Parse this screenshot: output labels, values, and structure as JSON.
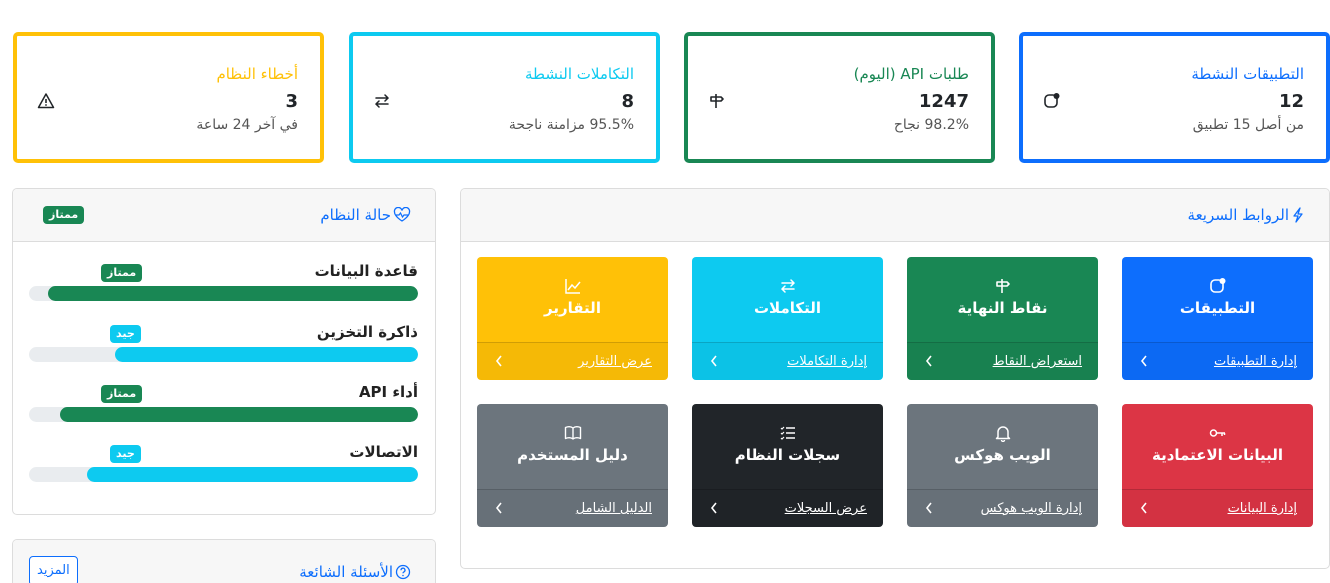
{
  "stats": [
    {
      "title": "التطبيقات النشطة",
      "value": "12",
      "sub": "من أصل 15 تطبيق",
      "color": "#0d6efd",
      "icon": "app-icon"
    },
    {
      "title": "طلبات API (اليوم)",
      "value": "1247",
      "sub": "98.2% نجاح",
      "color": "#198754",
      "icon": "signpost-icon"
    },
    {
      "title": "التكاملات النشطة",
      "value": "8",
      "sub": "95.5% مزامنة ناجحة",
      "color": "#0dcaf0",
      "icon": "arrows-exchange-icon"
    },
    {
      "title": "أخطاء النظام",
      "value": "3",
      "sub": "في آخر 24 ساعة",
      "color": "#ffc107",
      "icon": "warning-icon"
    }
  ],
  "system_status": {
    "title": "حالة النظام",
    "overall_badge": "ممتاز",
    "items": [
      {
        "label": "قاعدة البيانات",
        "badge": "ممتاز",
        "progress": 95
      },
      {
        "label": "ذاكرة التخزين",
        "badge": "جيد",
        "progress": 78
      },
      {
        "label": "أداء API",
        "badge": "ممتاز",
        "progress": 92
      },
      {
        "label": "الاتصالات",
        "badge": "جيد",
        "progress": 85
      }
    ]
  },
  "quick_links": {
    "title": "الروابط السريعة",
    "tiles": [
      {
        "title": "التطبيقات",
        "link": "إدارة التطبيقات",
        "icon": "app-icon",
        "color": "#0d6efd"
      },
      {
        "title": "نقاط النهاية",
        "link": "استعراض النقاط",
        "icon": "signpost-icon",
        "color": "#198754"
      },
      {
        "title": "التكاملات",
        "link": "إدارة التكاملات",
        "icon": "arrows-exchange-icon",
        "color": "#0dcaf0"
      },
      {
        "title": "التقارير",
        "link": "عرض التقارير",
        "icon": "chart-line-icon",
        "color": "#ffc107"
      },
      {
        "title": "البيانات الاعتمادية",
        "link": "إدارة البيانات",
        "icon": "key-icon",
        "color": "#dc3545"
      },
      {
        "title": "الويب هوكس",
        "link": "إدارة الويب هوكس",
        "icon": "bell-icon",
        "color": "#6c757d"
      },
      {
        "title": "سجلات النظام",
        "link": "عرض السجلات",
        "icon": "list-icon",
        "color": "#212529"
      },
      {
        "title": "دليل المستخدم",
        "link": "الدليل الشامل",
        "icon": "book-icon",
        "color": "#6c757d"
      }
    ]
  },
  "faq": {
    "title": "الأسئلة الشائعة",
    "more_label": "المزيد"
  }
}
